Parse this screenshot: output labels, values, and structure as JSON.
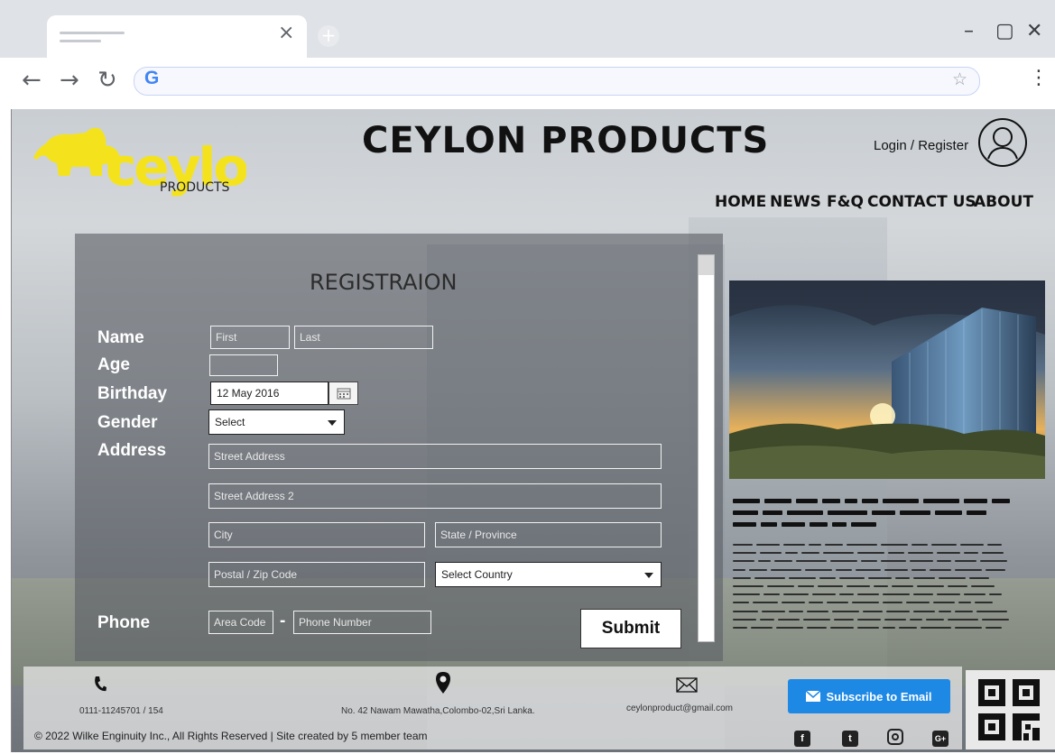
{
  "browser": {
    "window_controls": {
      "minimize": "–",
      "maximize": "▢",
      "close": "✕"
    },
    "tab": {
      "close": "×",
      "new_tab": "+"
    },
    "nav": {
      "back": "←",
      "forward": "→",
      "reload": "↻"
    },
    "address_value": "",
    "google_glyph": "G",
    "star": "☆",
    "menu": "⋮"
  },
  "site": {
    "title": "CEYLON PRODUCTS",
    "logo_text": "ceylon",
    "logo_sub": "PRODUCTS",
    "login": "Login / Register",
    "nav": [
      "HOME",
      "NEWS",
      "F&Q",
      "CONTACT US",
      "ABOUT"
    ]
  },
  "form": {
    "title": "REGISTRAION",
    "labels": {
      "name": "Name",
      "age": "Age",
      "birthday": "Birthday",
      "gender": "Gender",
      "address": "Address",
      "phone": "Phone"
    },
    "placeholders": {
      "first": "First",
      "last": "Last",
      "street1": "Street Address",
      "street2": "Street Address 2",
      "city": "City",
      "state": "State / Province",
      "zip": "Postal / Zip Code",
      "area_code": "Area Code",
      "phone_number": "Phone Number"
    },
    "values": {
      "age": "",
      "birthday": "12 May 2016",
      "gender": "Select",
      "country": "Select Country"
    },
    "phone_separator": "-",
    "submit": "Submit"
  },
  "footer": {
    "phone": "0111-11245701 / 154",
    "address": "No. 42 Nawam Mawatha,Colombo-02,Sri Lanka.",
    "email": "ceylonproduct@gmail.com",
    "copyright": "© 2022 Wilke Enginuity Inc., All Rights Reserved | Site created by 5 member team",
    "subscribe": "Subscribe to Email",
    "social": [
      "f",
      "t",
      "ig",
      "G+"
    ]
  },
  "colors": {
    "logo_yellow": "#f4e31c",
    "subscribe_blue": "#1e88e5",
    "panel": "#5c6066"
  }
}
